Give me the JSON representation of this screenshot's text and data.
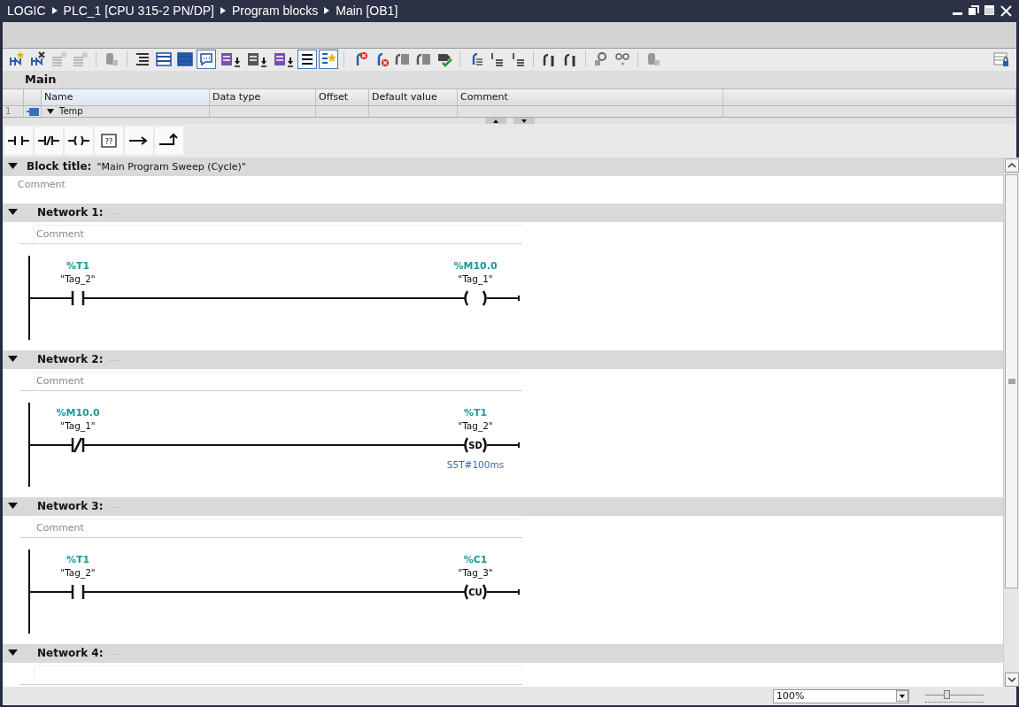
{
  "breadcrumb": [
    "LOGIC",
    "PLC_1 [CPU 315-2 PN/DP]",
    "Program blocks",
    "Main [OB1]"
  ],
  "block_name": "Main",
  "interface": {
    "columns": [
      "Name",
      "Data type",
      "Offset",
      "Default value",
      "Comment"
    ],
    "rows": [
      {
        "number": "1",
        "name": "Temp",
        "expanded": true
      }
    ]
  },
  "instruction_buttons": [
    {
      "kind": "no_contact"
    },
    {
      "kind": "nc_contact"
    },
    {
      "kind": "coil"
    },
    {
      "kind": "empty_box",
      "symbol": "??"
    },
    {
      "kind": "open_branch"
    },
    {
      "kind": "close_branch"
    }
  ],
  "block_title": {
    "label": "Block title:",
    "value": "\"Main Program Sweep (Cycle)\"",
    "expanded": true,
    "comment": "Comment"
  },
  "networks": [
    {
      "title": "Network 1:",
      "dots": "......",
      "expanded": true,
      "comment": "Comment",
      "contact": {
        "kind": "no",
        "address": "%T1",
        "tag": "\"Tag_2\""
      },
      "coil": {
        "kind": "coil",
        "address": "%M10.0",
        "tag": "\"Tag_1\""
      }
    },
    {
      "title": "Network 2:",
      "dots": "......",
      "expanded": true,
      "comment": "Comment",
      "contact": {
        "kind": "nc",
        "address": "%M10.0",
        "tag": "\"Tag_1\""
      },
      "coil": {
        "kind": "box",
        "label": "SD",
        "address": "%T1",
        "tag": "\"Tag_2\"",
        "parameter": "S5T#100ms"
      }
    },
    {
      "title": "Network 3:",
      "dots": "......",
      "expanded": true,
      "comment": "Comment",
      "contact": {
        "kind": "no",
        "address": "%T1",
        "tag": "\"Tag_2\""
      },
      "coil": {
        "kind": "box",
        "label": "CU",
        "address": "%C1",
        "tag": "\"Tag_3\""
      }
    },
    {
      "title": "Network 4:",
      "dots": "......",
      "expanded": true
    }
  ],
  "zoom": {
    "value": "100%"
  },
  "zoom_slider": {
    "level": 0.37
  }
}
